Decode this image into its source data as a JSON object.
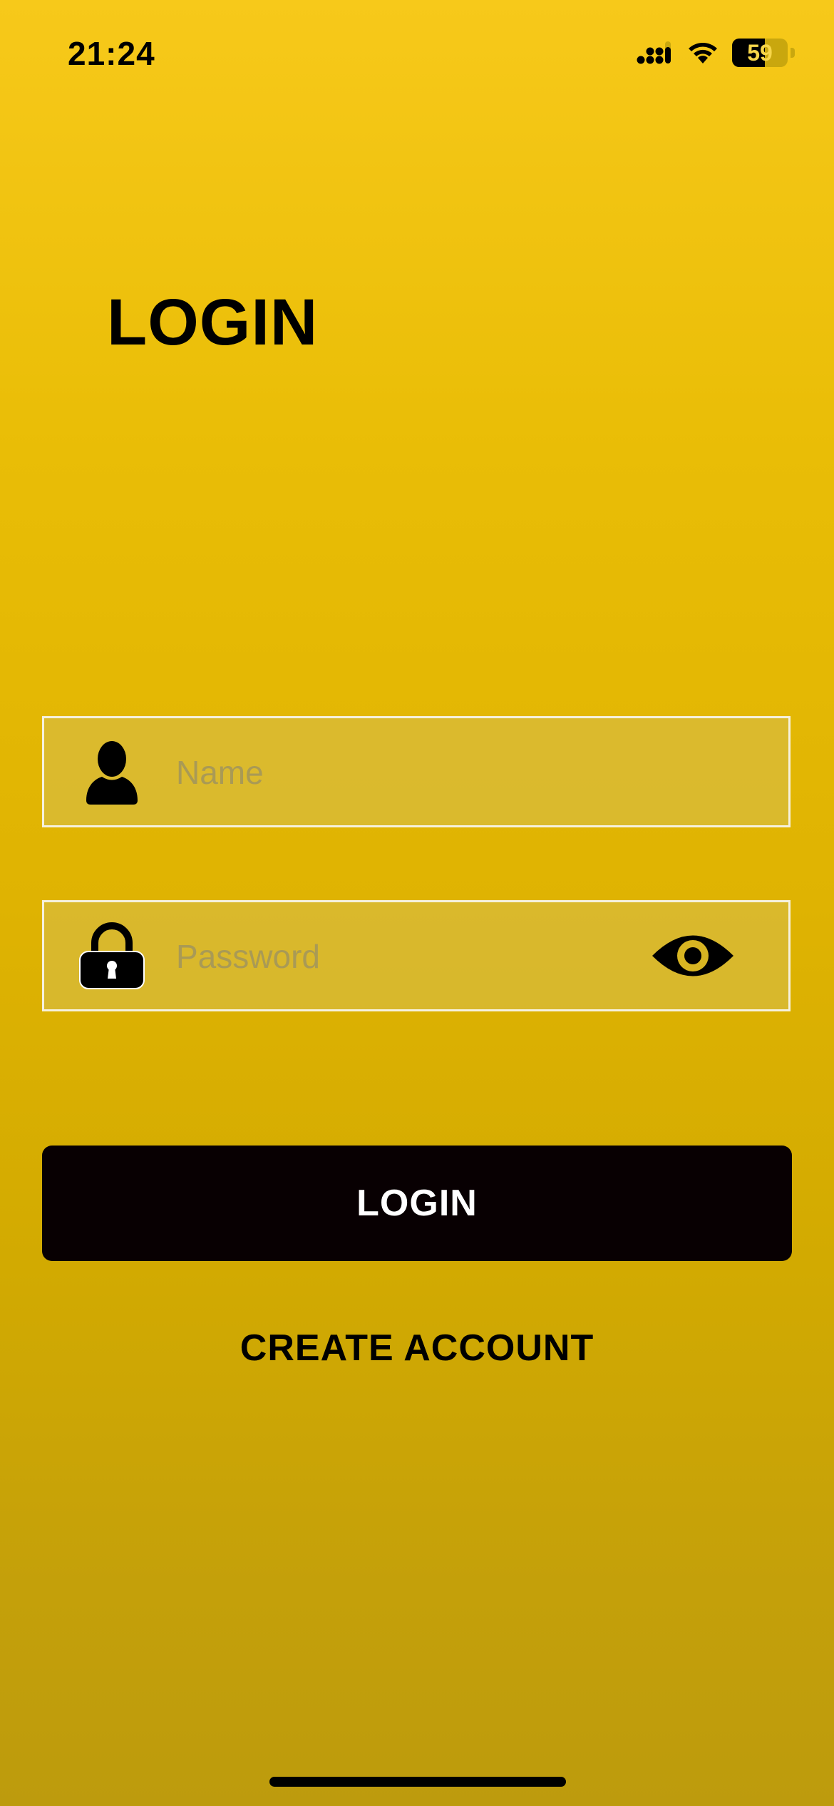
{
  "status_bar": {
    "time": "21:24",
    "battery_percent": "59",
    "battery_level": 0.59,
    "cellular_icon": "cellular-signal-icon",
    "wifi_icon": "wifi-icon"
  },
  "page": {
    "title": "LOGIN"
  },
  "form": {
    "name_field": {
      "placeholder": "Name",
      "value": "",
      "icon": "user-icon"
    },
    "password_field": {
      "placeholder": "Password",
      "value": "",
      "icon": "lock-icon",
      "toggle_icon": "eye-icon"
    },
    "login_label": "LOGIN",
    "create_account_label": "CREATE ACCOUNT"
  },
  "colors": {
    "background_top": "#f7c91a",
    "background_bottom": "#bd9b0d",
    "button_bg": "#080002",
    "button_text": "#ffffff",
    "field_border": "#f6f1de",
    "placeholder": "#a99a55"
  }
}
